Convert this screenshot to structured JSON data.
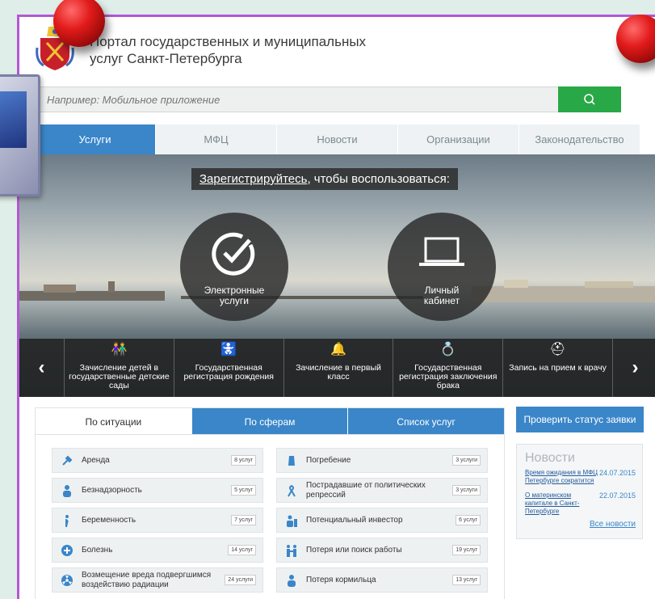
{
  "header": {
    "title_line1": "Портал государственных и муниципальных",
    "title_line2": "услуг Санкт-Петербурга"
  },
  "search": {
    "placeholder": "Например: Мобильное приложение"
  },
  "tabs": [
    {
      "label": "Услуги",
      "active": true
    },
    {
      "label": "МФЦ"
    },
    {
      "label": "Новости"
    },
    {
      "label": "Организации"
    },
    {
      "label": "Законодательство"
    }
  ],
  "hero": {
    "register_link": "Зарегистрируйтесь",
    "register_rest": ", чтобы воспользоваться:",
    "circle1_line1": "Электронные",
    "circle1_line2": "услуги",
    "circle2_line1": "Личный",
    "circle2_line2": "кабинет"
  },
  "carousel": [
    {
      "label": "Зачисление детей в государственные детские сады",
      "icon": "children-icon"
    },
    {
      "label": "Государственная регистрация рождения",
      "icon": "stroller-icon"
    },
    {
      "label": "Зачисление в первый класс",
      "icon": "bell-icon"
    },
    {
      "label": "Государственная регистрация заключения брака",
      "icon": "rings-icon"
    },
    {
      "label": "Запись на прием к врачу",
      "icon": "first-aid-icon"
    }
  ],
  "service_tabs": [
    {
      "label": "По ситуации",
      "active": true
    },
    {
      "label": "По сферам"
    },
    {
      "label": "Список услуг"
    }
  ],
  "situations_left": [
    {
      "label": "Аренда",
      "count": "8 услуг",
      "icon": "hammer-icon"
    },
    {
      "label": "Безнадзорность",
      "count": "5 услуг",
      "icon": "person-icon"
    },
    {
      "label": "Беременность",
      "count": "7 услуг",
      "icon": "pregnant-icon"
    },
    {
      "label": "Болезнь",
      "count": "14 услуг",
      "icon": "medical-icon"
    },
    {
      "label": "Возмещение вреда подвергшимся воздействию радиации",
      "count": "24 услуги",
      "icon": "radiation-icon"
    }
  ],
  "situations_right": [
    {
      "label": "Погребение",
      "count": "3 услуги",
      "icon": "monument-icon"
    },
    {
      "label": "Пострадавшие от политических репрессий",
      "count": "3 услуги",
      "icon": "ribbon-icon"
    },
    {
      "label": "Потенциальный инвестор",
      "count": "6 услуг",
      "icon": "investor-icon"
    },
    {
      "label": "Потеря или поиск работы",
      "count": "19 услуг",
      "icon": "people-icon"
    },
    {
      "label": "Потеря кормильца",
      "count": "13 услуг",
      "icon": "person-icon"
    }
  ],
  "status_button": "Проверить статус заявки",
  "news": {
    "heading": "Новости",
    "items": [
      {
        "title": "Время ожидания в МФЦ Петербурге сократится",
        "date": "24.07.2015"
      },
      {
        "title": "О материнском капитале в Санкт-Петербурге",
        "date": "22.07.2015"
      }
    ],
    "all_link": "Все новости"
  },
  "colors": {
    "accent_blue": "#3a86c8",
    "search_green": "#29a847",
    "frame_purple": "#b457d3"
  }
}
